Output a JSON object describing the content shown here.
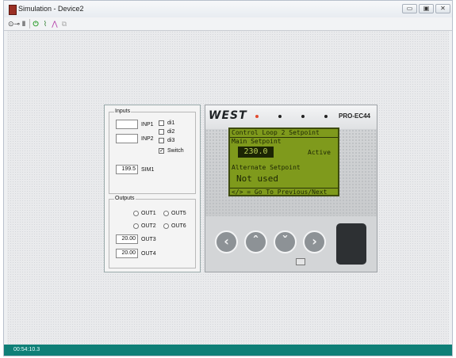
{
  "window": {
    "title": "Simulation - Device2"
  },
  "toolbar": {
    "items": [
      {
        "icon": "connect-icon",
        "glyph": "⊙⊸"
      },
      {
        "icon": "pause-icon",
        "glyph": "‖"
      },
      {
        "icon": "power-icon",
        "glyph": "⏻"
      },
      {
        "icon": "trend-chart-icon",
        "glyph": "📈"
      },
      {
        "icon": "chart-icon",
        "glyph": "📉"
      },
      {
        "icon": "copy-icon",
        "glyph": "⧉"
      }
    ]
  },
  "inputs": {
    "label": "Inputs",
    "inp1": {
      "label": "INP1",
      "value": ""
    },
    "inp2": {
      "label": "INP2",
      "value": ""
    },
    "di1": {
      "label": "di1",
      "checked": false
    },
    "di2": {
      "label": "di2",
      "checked": false
    },
    "di3": {
      "label": "di3",
      "checked": false
    },
    "switch": {
      "label": "Switch",
      "checked": true
    },
    "sim1": {
      "label": "SIM1",
      "value": "199.5"
    }
  },
  "outputs": {
    "label": "Outputs",
    "out1": "OUT1",
    "out2": "OUT2",
    "out5": "OUT5",
    "out6": "OUT6",
    "out3": {
      "label": "OUT3",
      "value": "20.00"
    },
    "out4": {
      "label": "OUT4",
      "value": "20.00"
    }
  },
  "device": {
    "brand": "WEST",
    "model": "PRO-EC44",
    "lcd": {
      "header": "Control Loop 2 Setpoint",
      "main_label": "Main Setpoint",
      "main_value": "230.0",
      "status": "Active",
      "alt_label": "Alternate Setpoint",
      "alt_value": "Not used",
      "footer": "</> = Go To Previous/Next"
    },
    "buttons": [
      "‹",
      "ˆ",
      "ˇ",
      "›"
    ]
  },
  "status": {
    "time": "00:54:10.3"
  },
  "colors": {
    "statusbar": "#0f7f77",
    "lcd": "#7f9a1c"
  }
}
